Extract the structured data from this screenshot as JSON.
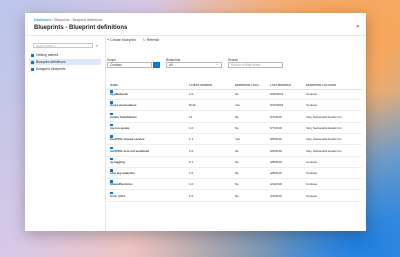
{
  "breadcrumb": {
    "home": "Dashboard",
    "sep": ">",
    "current": "Blueprints - Blueprint definitions"
  },
  "page_title": "Blueprints - Blueprint definitions",
  "sidebar": {
    "search_placeholder": "Search (Ctrl+/)",
    "items": [
      {
        "label": "Getting started"
      },
      {
        "label": "Blueprint definitions",
        "active": true
      },
      {
        "label": "Assigned blueprints"
      }
    ]
  },
  "toolbar": {
    "create_label": "Create blueprint",
    "refresh_label": "Refresh"
  },
  "filters": {
    "scope_label": "Scope",
    "scope_value": "Contoso",
    "blueprints_label": "Blueprints",
    "blueprints_value": "All",
    "search_label": "Search",
    "search_placeholder": "Search to filter items..."
  },
  "table": {
    "columns": [
      "NAME",
      "LATEST VERSION",
      "DEFINITION LOCA...",
      "LAST MODIFIED",
      "DEFINITION LOCATION"
    ],
    "rows": [
      {
        "name": "AppNetwork",
        "version": "1.0",
        "published": "No",
        "modified": "5/20/2019",
        "location": "Contoso"
      },
      {
        "name": "Azure Governance",
        "version": "Draft",
        "published": "Yes",
        "modified": "5/16/2019",
        "location": "Contoso"
      },
      {
        "name": "hotels foundations",
        "version": "12",
        "published": "No",
        "modified": "5/7/2019",
        "location": "Very Successful Hotels Inc."
      },
      {
        "name": "my-iso-spoke",
        "version": "1.0",
        "published": "No",
        "modified": "5/7/2019",
        "location": "Very Successful Hotels Inc."
      },
      {
        "name": "iso27001 shared service",
        "version": "1.1",
        "published": "Yes",
        "modified": "5/6/2019",
        "location": "Very Successful Hotels Inc."
      },
      {
        "name": "iso27001 asm vnt workload",
        "version": "1.0",
        "published": "No",
        "modified": "5/6/2019",
        "location": "Very Successful Hotels Inc."
      },
      {
        "name": "rg-tagging",
        "version": "0.1",
        "published": "No",
        "modified": "4/8/2019",
        "location": "Contoso"
      },
      {
        "name": "sme log analytics",
        "version": "1.0",
        "published": "No",
        "modified": "4/8/2019",
        "location": "Contoso"
      },
      {
        "name": "SharedServices",
        "version": "1.0",
        "published": "No",
        "modified": "4/4/2019",
        "location": "Contoso"
      },
      {
        "name": "Core_Infra",
        "version": "1.0",
        "published": "No",
        "modified": "4/4/2019",
        "location": "Contoso"
      }
    ]
  }
}
